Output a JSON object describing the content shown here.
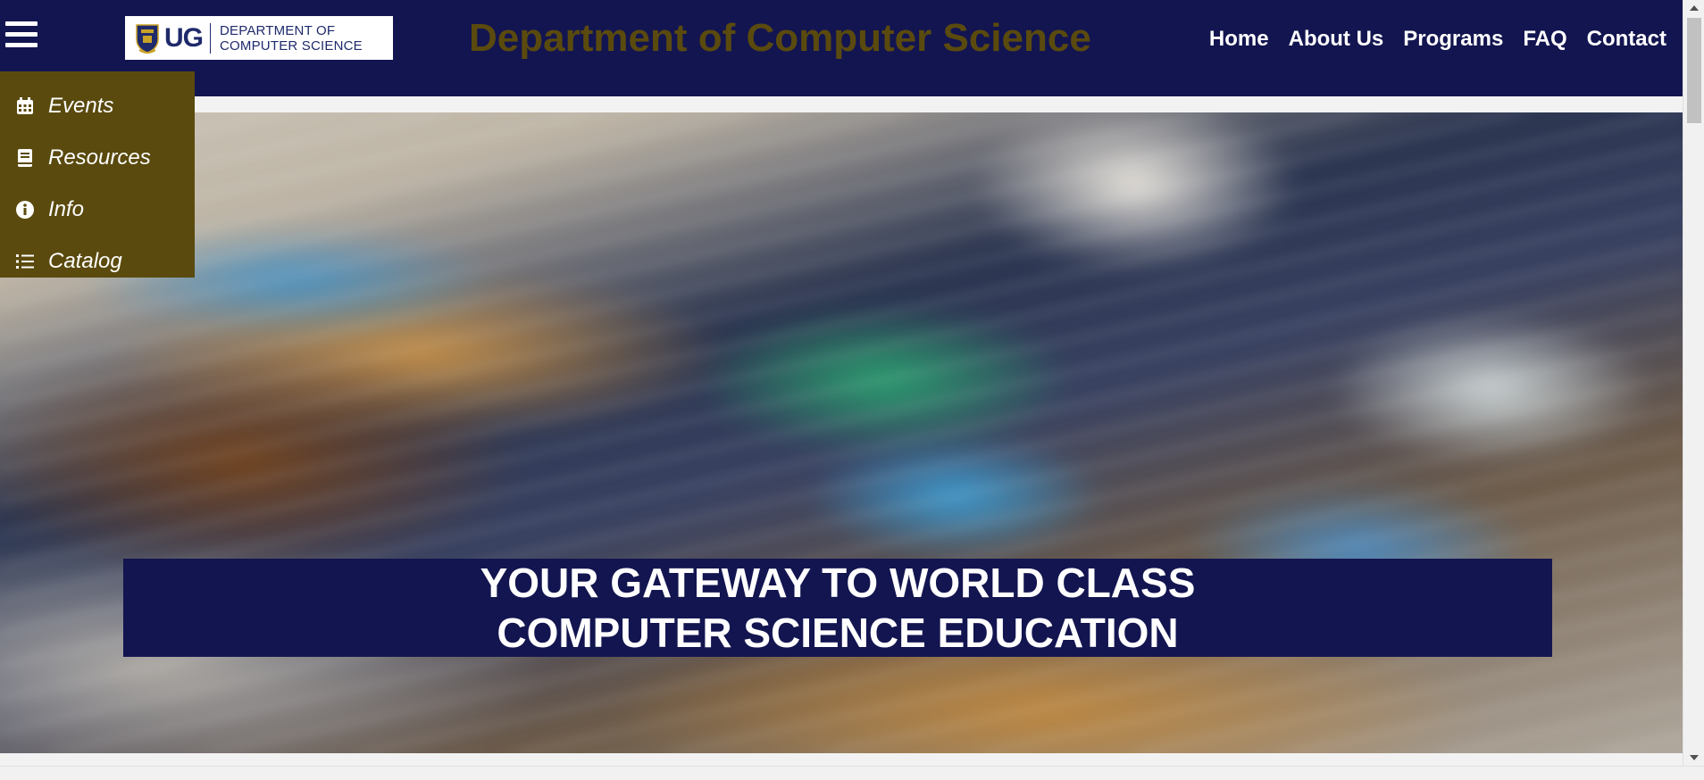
{
  "header": {
    "logo": {
      "ug_text": "UG",
      "dept_line1": "DEPARTMENT OF",
      "dept_line2": "COMPUTER SCIENCE"
    },
    "title": "Department of Computer Science",
    "nav": [
      {
        "label": "Home"
      },
      {
        "label": "About Us"
      },
      {
        "label": "Programs"
      },
      {
        "label": "FAQ"
      },
      {
        "label": "Contact"
      }
    ]
  },
  "sidemenu": {
    "items": [
      {
        "label": "Events",
        "icon": "calendar-icon"
      },
      {
        "label": "Resources",
        "icon": "book-icon"
      },
      {
        "label": "Info",
        "icon": "info-icon"
      },
      {
        "label": "Catalog",
        "icon": "list-icon"
      }
    ]
  },
  "hero": {
    "line1": "YOUR GATEWAY TO WORLD CLASS",
    "line2": "COMPUTER SCIENCE EDUCATION"
  },
  "colors": {
    "header_bg": "#131550",
    "accent_gold": "#5a4a0e",
    "text_white": "#ffffff"
  }
}
